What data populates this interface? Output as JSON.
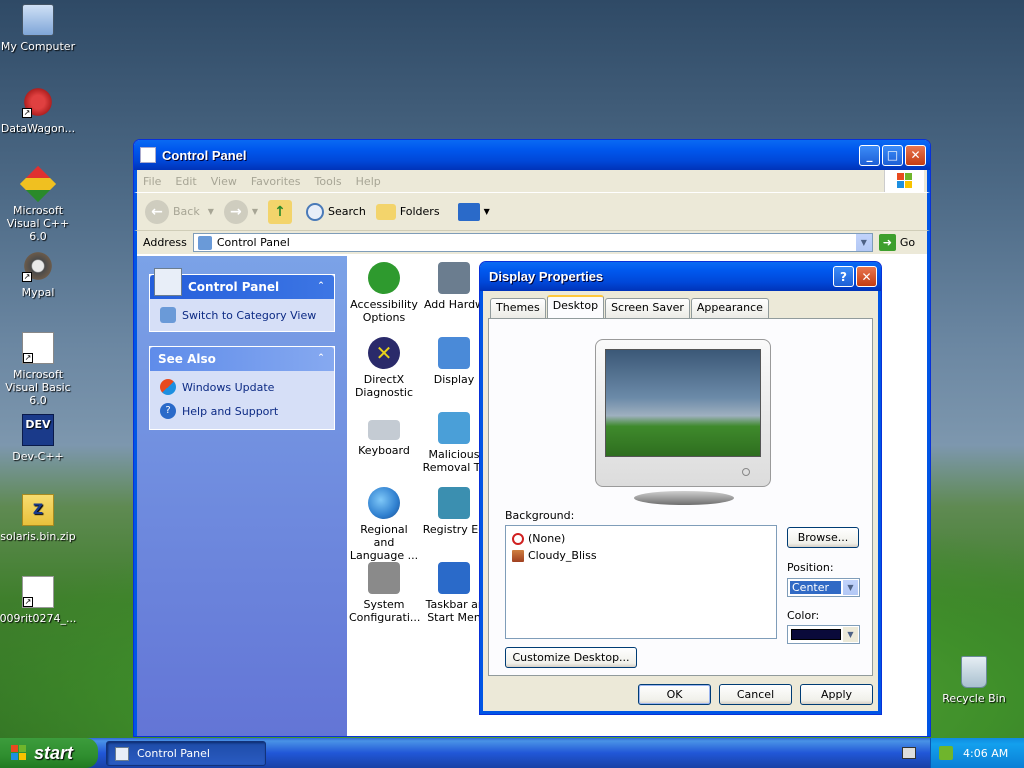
{
  "desktop": {
    "icons": [
      {
        "label": "My Computer",
        "icon": "my-computer-icon"
      },
      {
        "label": "DataWagon...",
        "icon": "datawagon-icon"
      },
      {
        "label": "Microsoft Visual C++ 6.0",
        "icon": "visual-cpp-icon"
      },
      {
        "label": "Mypal",
        "icon": "mypal-icon"
      },
      {
        "label": "Microsoft Visual Basic 6.0",
        "icon": "visual-basic-icon"
      },
      {
        "label": "Dev-C++",
        "icon": "dev-cpp-icon"
      },
      {
        "label": "solaris.bin.zip",
        "icon": "zip-file-icon"
      },
      {
        "label": "009rit0274_...",
        "icon": "document-icon"
      }
    ],
    "recycle_bin": "Recycle Bin"
  },
  "control_panel": {
    "title": "Control Panel",
    "menu": [
      "File",
      "Edit",
      "View",
      "Favorites",
      "Tools",
      "Help"
    ],
    "toolbar": {
      "back": "Back",
      "search": "Search",
      "folders": "Folders"
    },
    "address_label": "Address",
    "address_value": "Control Panel",
    "go_label": "Go",
    "task_pane": {
      "header": "Control Panel",
      "switch_link": "Switch to Category View",
      "see_also_header": "See Also",
      "see_also_items": [
        "Windows Update",
        "Help and Support"
      ]
    },
    "items": [
      {
        "label": "Accessibility Options",
        "color": "#2e9a2e"
      },
      {
        "label": "Add Hardw",
        "color": "#6b7d8f"
      },
      {
        "label": "DirectX Diagnostic",
        "color": "#d9c31a"
      },
      {
        "label": "Display",
        "color": "#4a8ad8"
      },
      {
        "label": "Keyboard",
        "color": "#9ca6b3"
      },
      {
        "label": "Malicious Removal To",
        "color": "#4a9fd8"
      },
      {
        "label": "Regional and Language ...",
        "color": "#2f7fcf"
      },
      {
        "label": "Registry Ed",
        "color": "#3b8fb0"
      },
      {
        "label": "System Configurati...",
        "color": "#777777"
      },
      {
        "label": "Taskbar ar Start Men",
        "color": "#2a6ac9"
      }
    ]
  },
  "display_properties": {
    "title": "Display Properties",
    "tabs": [
      "Themes",
      "Desktop",
      "Screen Saver",
      "Appearance"
    ],
    "active_tab": "Desktop",
    "background_label": "Background:",
    "background_items": [
      "(None)",
      "Cloudy_Bliss"
    ],
    "browse": "Browse...",
    "position_label": "Position:",
    "position_value": "Center",
    "color_label": "Color:",
    "color_value": "#0a0a3a",
    "customize": "Customize Desktop...",
    "ok": "OK",
    "cancel": "Cancel",
    "apply": "Apply"
  },
  "taskbar": {
    "start": "start",
    "task": "Control Panel",
    "clock": "4:06 AM"
  }
}
